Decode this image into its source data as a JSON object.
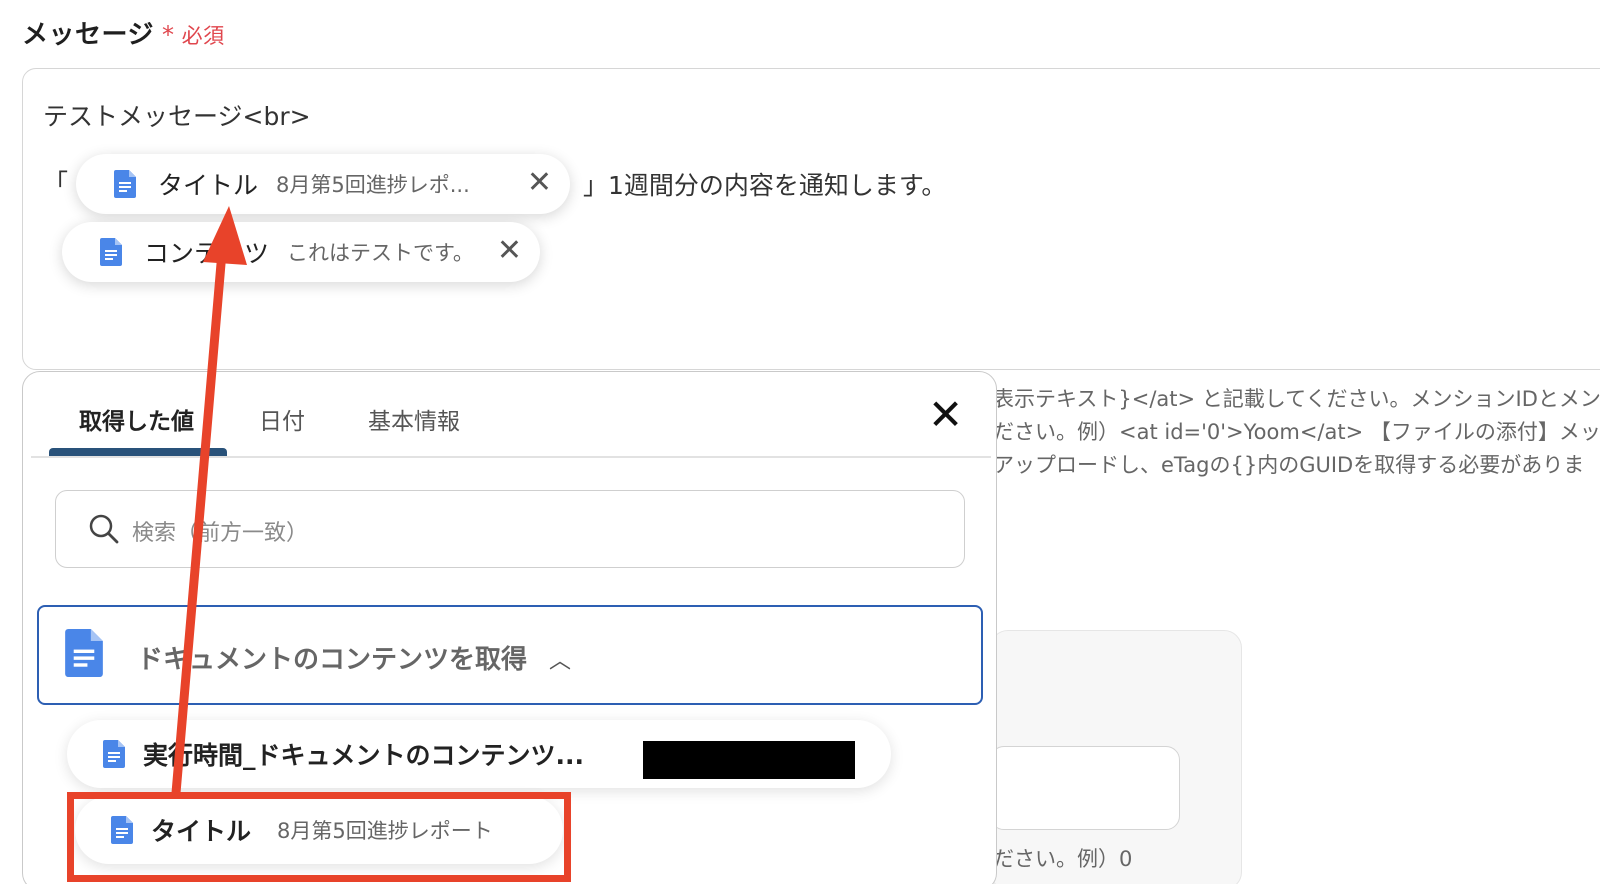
{
  "field": {
    "label": "メッセージ",
    "required_star": "*",
    "required_text": "必須"
  },
  "message": {
    "line1": "テストメッセージ<br>",
    "bracket_open": "「",
    "line2_rest": "」1週間分の内容を通知します。",
    "chips": [
      {
        "name": "タイトル",
        "value": "8月第5回進捗レポ...",
        "close": "✕"
      },
      {
        "name": "コンテンツ",
        "value": "これはテストです。",
        "close": "✕"
      }
    ]
  },
  "helper_text": [
    "表示テキスト}</at> と記載してください。メンションIDとメン",
    "ださい。例）<at id='0'>Yoom</at>  【ファイルの添付】メッ",
    "アップロードし、eTagの{}内のGUIDを取得する必要がありま",
    "ださい。例）0"
  ],
  "popup": {
    "tabs": [
      "取得した値",
      "日付",
      "基本情報"
    ],
    "close": "✕",
    "search_placeholder": "検索（前方一致）",
    "group_label": "ドキュメントのコンテンツを取得",
    "group_chevron": "︿",
    "items": [
      {
        "name": "実行時間_ドキュメントのコンテンツ...",
        "value": ""
      },
      {
        "name": "タイトル",
        "value": "8月第5回進捗レポート"
      }
    ]
  },
  "colors": {
    "required": "#e0464d",
    "tab_underline": "#29527a",
    "group_border": "#2d5fb3",
    "doc_icon": "#4a86e8",
    "annotation": "#e8432a"
  }
}
